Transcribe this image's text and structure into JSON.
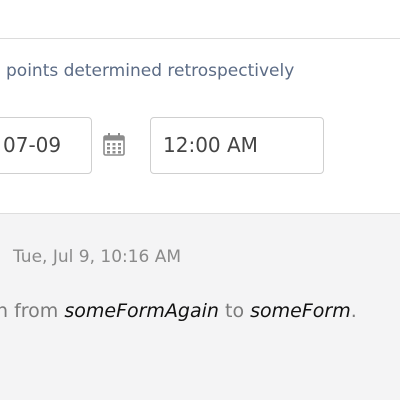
{
  "form": {
    "label_text": "points determined retrospectively",
    "date_value": "07-09",
    "time_value": "12:00 AM",
    "calendar_icon": "calendar-icon"
  },
  "history": {
    "timestamp": "Tue, Jul 9, 10:16 AM",
    "change_prefix": "n from ",
    "from_value": "someFormAgain",
    "change_middle": " to ",
    "to_value": "someForm",
    "change_suffix": "."
  }
}
